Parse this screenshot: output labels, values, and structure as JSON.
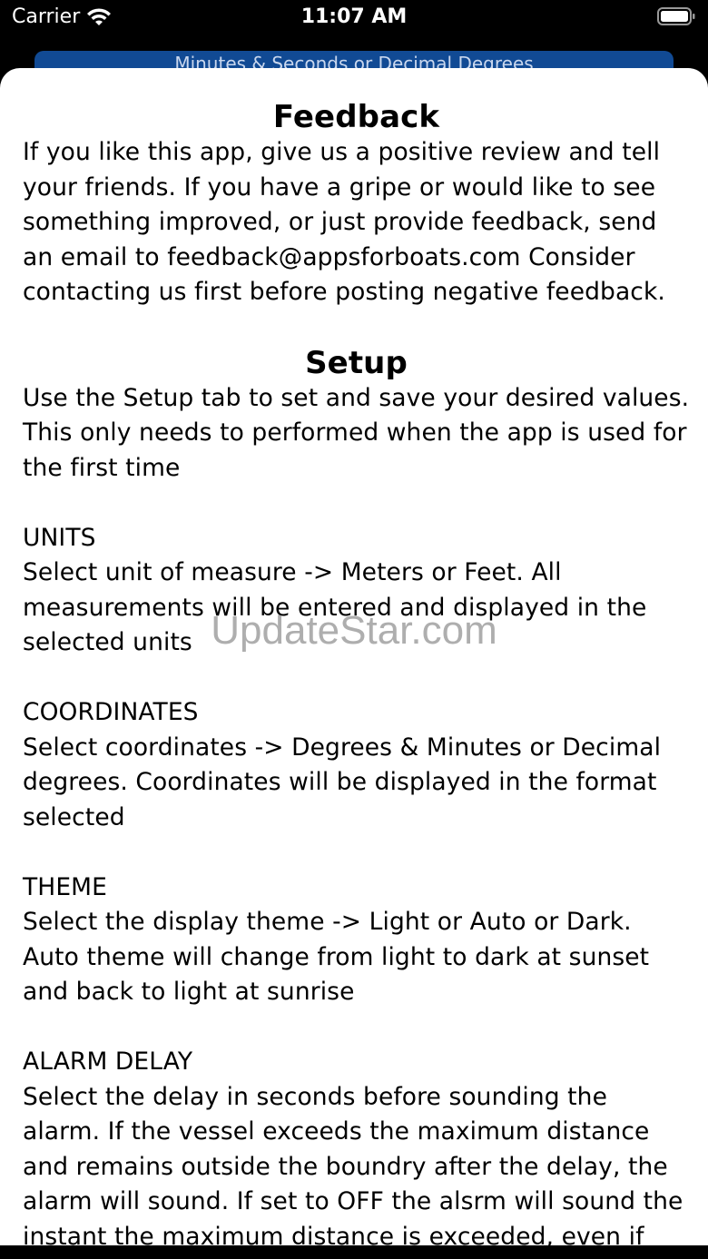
{
  "status_bar": {
    "carrier": "Carrier",
    "time": "11:07 AM"
  },
  "background": {
    "bar_text": "Minutes & Seconds or Decimal Degrees",
    "bar_color": "#114a94"
  },
  "feedback": {
    "title": "Feedback",
    "body": "If you like this app, give us a positive review and tell your friends. If you have a gripe or would like to see something improved, or just provide feedback, send an email to feedback@appsforboats.com Consider contacting us first before posting negative feedback."
  },
  "setup": {
    "title": "Setup",
    "intro": "Use the Setup tab to set and save your desired values. This only needs to performed when the app is used for the first time",
    "items": [
      {
        "heading": "UNITS",
        "text": "Select unit of measure -> Meters or Feet. All measurements will be entered and displayed in the selected units"
      },
      {
        "heading": "COORDINATES",
        "text": "Select coordinates -> Degrees & Minutes or Decimal degrees. Coordinates will be displayed in the format selected"
      },
      {
        "heading": "THEME",
        "text": "Select the display theme -> Light or Auto or Dark. Auto theme will change from light to dark at sunset and back to light at sunrise"
      },
      {
        "heading": "ALARM DELAY",
        "text": "Select the delay in seconds before sounding the alarm. If the vessel exceeds the maximum distance and remains outside the boundry after the delay, the alarm will sound. If set to OFF the alsrm will sound the instant the maximum distance is exceeded, even if"
      }
    ]
  },
  "watermark": "UpdateStar.com"
}
